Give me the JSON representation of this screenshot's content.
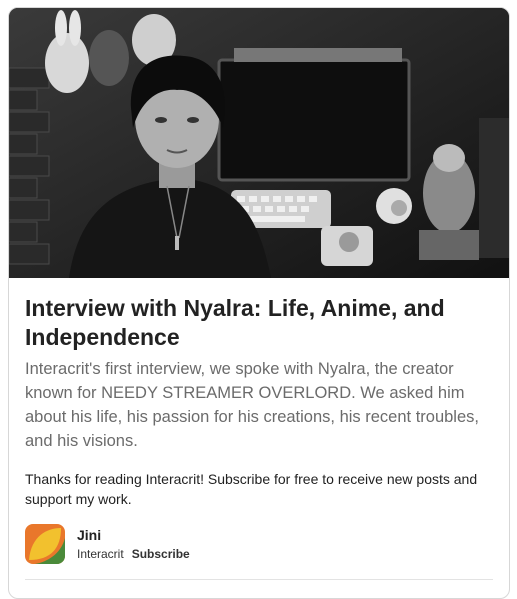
{
  "article": {
    "title": "Interview with Nyalra: Life, Anime, and Independence",
    "subtitle": "Interacrit's first interview, we spoke with Nyalra, the creator known for NEEDY STREAMER OVERLORD. We asked him about his life, his passion for his creations, his recent troubles, and his visions.",
    "note": "Thanks for reading Interacrit! Subscribe for free to receive new posts and support my work."
  },
  "author": {
    "name": "Jini",
    "publication": "Interacrit",
    "subscribe_label": "Subscribe"
  },
  "colors": {
    "title": "#222222",
    "subtitle": "#6b6b6b",
    "avatar_orange": "#e9772b",
    "avatar_yellow": "#f2c12e",
    "avatar_green": "#4a8a3a"
  }
}
